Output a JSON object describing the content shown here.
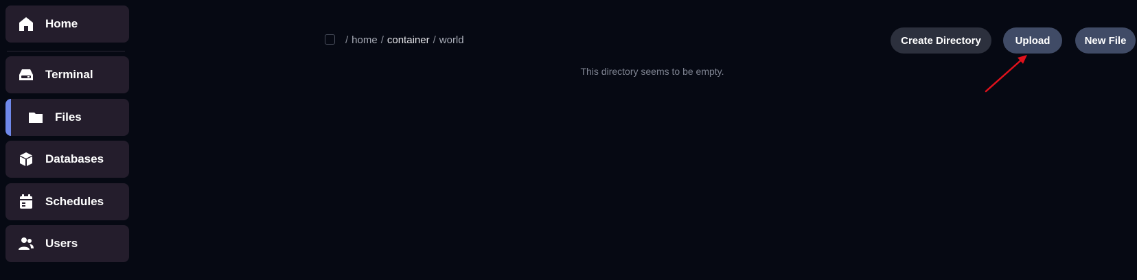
{
  "sidebar": {
    "items": [
      {
        "label": "Home",
        "icon": "home-icon"
      },
      {
        "label": "Terminal",
        "icon": "terminal-icon"
      },
      {
        "label": "Files",
        "icon": "folder-icon",
        "active": true
      },
      {
        "label": "Databases",
        "icon": "database-icon"
      },
      {
        "label": "Schedules",
        "icon": "calendar-icon"
      },
      {
        "label": "Users",
        "icon": "users-icon"
      }
    ]
  },
  "breadcrumb": {
    "segments": [
      "home",
      "container",
      "world"
    ],
    "separator": "/"
  },
  "toolbar": {
    "create_directory_label": "Create Directory",
    "upload_label": "Upload",
    "new_file_label": "New File"
  },
  "main": {
    "empty_message": "This directory seems to be empty."
  },
  "colors": {
    "background": "#060913",
    "sidebar_item": "#241d2c",
    "active_accent": "#6f88ea",
    "annotation_arrow": "#e0111b"
  }
}
